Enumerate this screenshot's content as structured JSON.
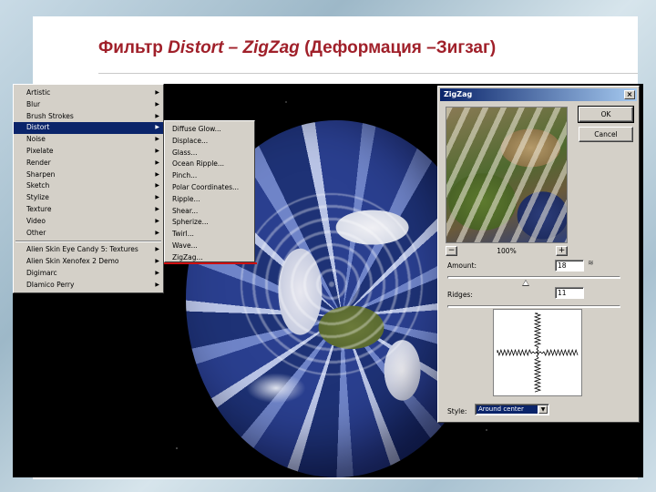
{
  "slide": {
    "title_prefix": "Фильтр ",
    "title_italic": "Distort – ZigZag",
    "title_suffix": " (Деформация –Зигзаг)"
  },
  "colors": {
    "title": "#a0202a",
    "menu_highlight": "#0a246a",
    "zigzag_marker": "#d01010"
  },
  "filter_menu": {
    "group1": [
      {
        "label": "Artistic",
        "submenu": true
      },
      {
        "label": "Blur",
        "submenu": true
      },
      {
        "label": "Brush Strokes",
        "submenu": true
      },
      {
        "label": "Distort",
        "submenu": true,
        "selected": true
      },
      {
        "label": "Noise",
        "submenu": true
      },
      {
        "label": "Pixelate",
        "submenu": true
      },
      {
        "label": "Render",
        "submenu": true
      },
      {
        "label": "Sharpen",
        "submenu": true
      },
      {
        "label": "Sketch",
        "submenu": true
      },
      {
        "label": "Stylize",
        "submenu": true
      },
      {
        "label": "Texture",
        "submenu": true
      },
      {
        "label": "Video",
        "submenu": true
      },
      {
        "label": "Other",
        "submenu": true
      }
    ],
    "group2": [
      {
        "label": "Alien Skin Eye Candy 5: Textures",
        "submenu": true
      },
      {
        "label": "Alien Skin Xenofex 2 Demo",
        "submenu": true
      },
      {
        "label": "Digimarc",
        "submenu": true
      },
      {
        "label": "DIamico Perry",
        "submenu": true
      }
    ],
    "arrow_glyph": "▶"
  },
  "distort_menu": {
    "items": [
      "Diffuse Glow...",
      "Displace...",
      "Glass...",
      "Ocean Ripple...",
      "Pinch...",
      "Polar Coordinates...",
      "Ripple...",
      "Shear...",
      "Spherize...",
      "Twirl...",
      "Wave...",
      "ZigZag..."
    ]
  },
  "dialog": {
    "title": "ZigZag",
    "close_glyph": "×",
    "ok_label": "OK",
    "cancel_label": "Cancel",
    "zoom_out": "−",
    "zoom_in": "+",
    "zoom_level": "100%",
    "amount_label": "Amount:",
    "amount_value": "18",
    "amount_fraction": 0.45,
    "ridges_label": "Ridges:",
    "ridges_value": "11",
    "ridges_fraction": 0.44,
    "style_label": "Style:",
    "style_value": "Around center",
    "dropdown_glyph": "▼",
    "settings_icon": "≋"
  }
}
